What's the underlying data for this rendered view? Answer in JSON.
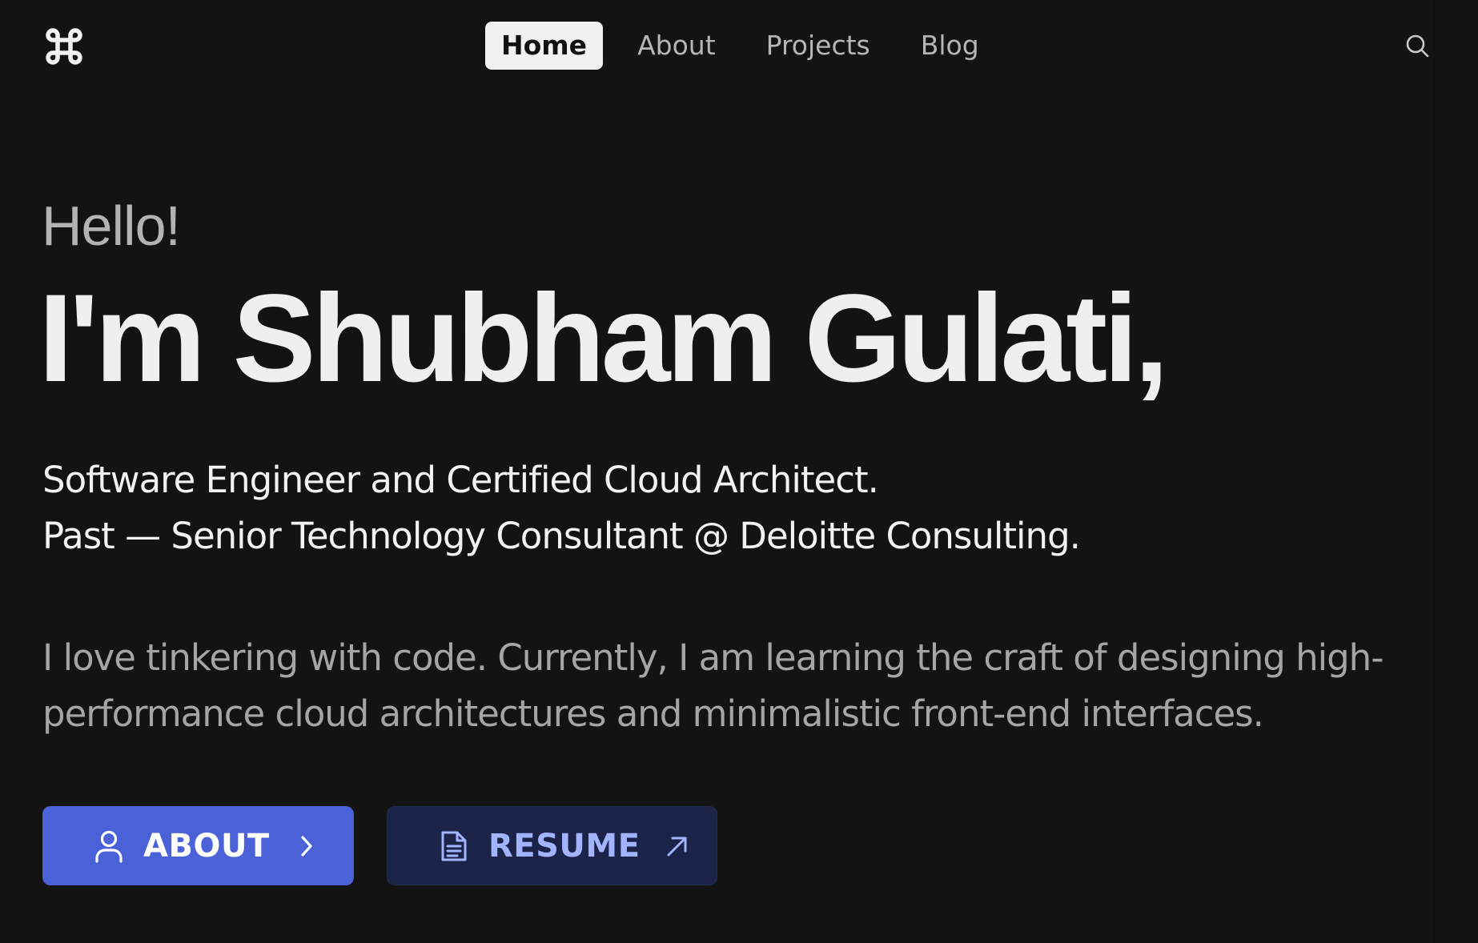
{
  "header": {
    "logo_icon": "command-key-icon",
    "nav": [
      {
        "label": "Home",
        "active": true
      },
      {
        "label": "About",
        "active": false
      },
      {
        "label": "Projects",
        "active": false
      },
      {
        "label": "Blog",
        "active": false
      }
    ],
    "search_icon": "search-icon"
  },
  "hero": {
    "greeting": "Hello!",
    "headline": "I'm Shubham Gulati,",
    "role_line_1": "Software Engineer and Certified Cloud Architect.",
    "role_line_2": "Past — Senior Technology Consultant @ Deloitte Consulting.",
    "bio": "I love tinkering with code. Currently, I am learning the craft of designing high-performance cloud architectures and minimalistic front-end interfaces."
  },
  "actions": {
    "about": {
      "label": "ABOUT",
      "icon": "user-icon",
      "trailing_icon": "chevron-right-icon"
    },
    "resume": {
      "label": "RESUME",
      "icon": "document-icon",
      "trailing_icon": "arrow-up-right-icon"
    }
  },
  "colors": {
    "background": "#111112",
    "primary_button": "#4a61d7",
    "secondary_button": "#1b2348",
    "secondary_button_text": "#a3b4ff",
    "active_nav_bg": "#f1f1f1"
  }
}
